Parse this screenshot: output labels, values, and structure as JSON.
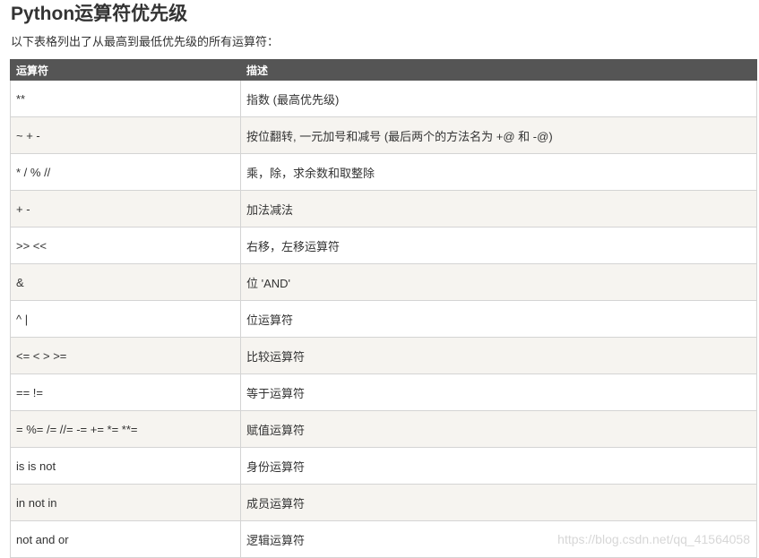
{
  "title": "Python运算符优先级",
  "intro": "以下表格列出了从最高到最低优先级的所有运算符：",
  "table": {
    "headers": {
      "operator": "运算符",
      "description": "描述"
    },
    "rows": [
      {
        "operator": "**",
        "description": "指数 (最高优先级)"
      },
      {
        "operator": "~ + -",
        "description": "按位翻转, 一元加号和减号 (最后两个的方法名为 +@ 和 -@)"
      },
      {
        "operator": "* / % //",
        "description": "乘，除，求余数和取整除"
      },
      {
        "operator": "+ -",
        "description": "加法减法"
      },
      {
        "operator": ">> <<",
        "description": "右移，左移运算符"
      },
      {
        "operator": "&",
        "description": "位 'AND'"
      },
      {
        "operator": "^ |",
        "description": "位运算符"
      },
      {
        "operator": "<= < > >=",
        "description": "比较运算符"
      },
      {
        "operator": "== !=",
        "description": "等于运算符"
      },
      {
        "operator": "= %= /= //= -= += *= **=",
        "description": "赋值运算符"
      },
      {
        "operator": "is is not",
        "description": "身份运算符"
      },
      {
        "operator": "in not in",
        "description": "成员运算符"
      },
      {
        "operator": "not and or",
        "description": "逻辑运算符"
      }
    ]
  },
  "watermark": "https://blog.csdn.net/qq_41564058"
}
